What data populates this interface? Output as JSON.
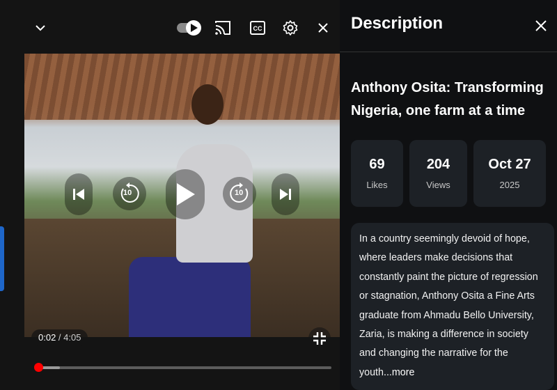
{
  "player": {
    "icons": {
      "collapse": "chevron-down-icon",
      "autoplay": "autoplay-toggle-icon",
      "cast": "cast-icon",
      "captions": "closed-captions-icon",
      "settings": "gear-icon",
      "close": "close-icon",
      "previous": "skip-previous-icon",
      "rewind": "rewind-10-icon",
      "play": "play-icon",
      "forward": "forward-10-icon",
      "next": "skip-next-icon",
      "fullscreen_exit": "exit-fullscreen-icon"
    },
    "rewind_label": "10",
    "forward_label": "10",
    "current_time": "0:02",
    "separator": " / ",
    "duration": "4:05",
    "progress_played_fraction": 0.008,
    "progress_buffered_fraction": 0.08
  },
  "description": {
    "heading": "Description",
    "title": "Anthony Osita: Transforming Nigeria, one farm at a time",
    "stats": [
      {
        "value": "69",
        "label": "Likes"
      },
      {
        "value": "204",
        "label": "Views"
      },
      {
        "value": "Oct 27",
        "label": "2025"
      }
    ],
    "body": "In a country seemingly devoid of hope, where leaders make decisions that constantly paint the picture of regression or stagnation, Anthony Osita a Fine Arts graduate from Ahmadu Bello University, Zaria, is making a difference in society and changing the narrative for the youth",
    "more": "...more"
  },
  "colors": {
    "accent": "#ff0000",
    "card": "#1d2126",
    "side_tab": "#1e66c9"
  }
}
